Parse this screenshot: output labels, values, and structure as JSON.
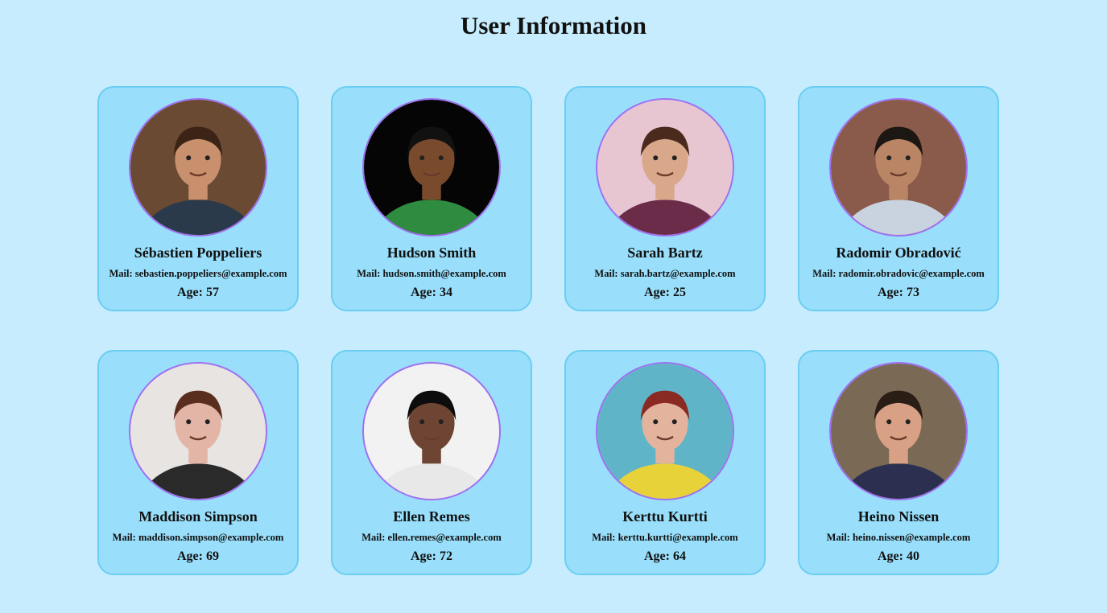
{
  "page": {
    "title": "User Information"
  },
  "users": [
    {
      "name": "Sébastien Poppeliers",
      "mail_label": "Mail: sebastien.poppeliers@example.com",
      "age_label": "Age: 57",
      "photo": {
        "bg": "#6b4a33",
        "skin": "#c9906e",
        "hair": "#3b2416",
        "shirt": "#2a3a4a"
      }
    },
    {
      "name": "Hudson Smith",
      "mail_label": "Mail: hudson.smith@example.com",
      "age_label": "Age: 34",
      "photo": {
        "bg": "#050505",
        "skin": "#7a4a2c",
        "hair": "#111111",
        "shirt": "#2e8b3f"
      }
    },
    {
      "name": "Sarah Bartz",
      "mail_label": "Mail: sarah.bartz@example.com",
      "age_label": "Age: 25",
      "photo": {
        "bg": "#e7c6d2",
        "skin": "#d9a88a",
        "hair": "#4a2a1c",
        "shirt": "#6b2c4a"
      }
    },
    {
      "name": "Radomir Obradović",
      "mail_label": "Mail: radomir.obradovic@example.com",
      "age_label": "Age: 73",
      "photo": {
        "bg": "#8a5a4a",
        "skin": "#b98565",
        "hair": "#1d1714",
        "shirt": "#c9d3e0"
      }
    },
    {
      "name": "Maddison Simpson",
      "mail_label": "Mail: maddison.simpson@example.com",
      "age_label": "Age: 69",
      "photo": {
        "bg": "#e8e4e2",
        "skin": "#e2b5a6",
        "hair": "#5a2e1e",
        "shirt": "#2a2a2a"
      }
    },
    {
      "name": "Ellen Remes",
      "mail_label": "Mail: ellen.remes@example.com",
      "age_label": "Age: 72",
      "photo": {
        "bg": "#f2f2f2",
        "skin": "#6e4532",
        "hair": "#0d0d0d",
        "shirt": "#e8e8e8"
      }
    },
    {
      "name": "Kerttu Kurtti",
      "mail_label": "Mail: kerttu.kurtti@example.com",
      "age_label": "Age: 64",
      "photo": {
        "bg": "#5fb5c7",
        "skin": "#e3b39e",
        "hair": "#8a2a22",
        "shirt": "#e8d23a"
      }
    },
    {
      "name": "Heino Nissen",
      "mail_label": "Mail: heino.nissen@example.com",
      "age_label": "Age: 40",
      "photo": {
        "bg": "#7a6a55",
        "skin": "#d8a084",
        "hair": "#2a1d15",
        "shirt": "#2c3050"
      }
    }
  ]
}
